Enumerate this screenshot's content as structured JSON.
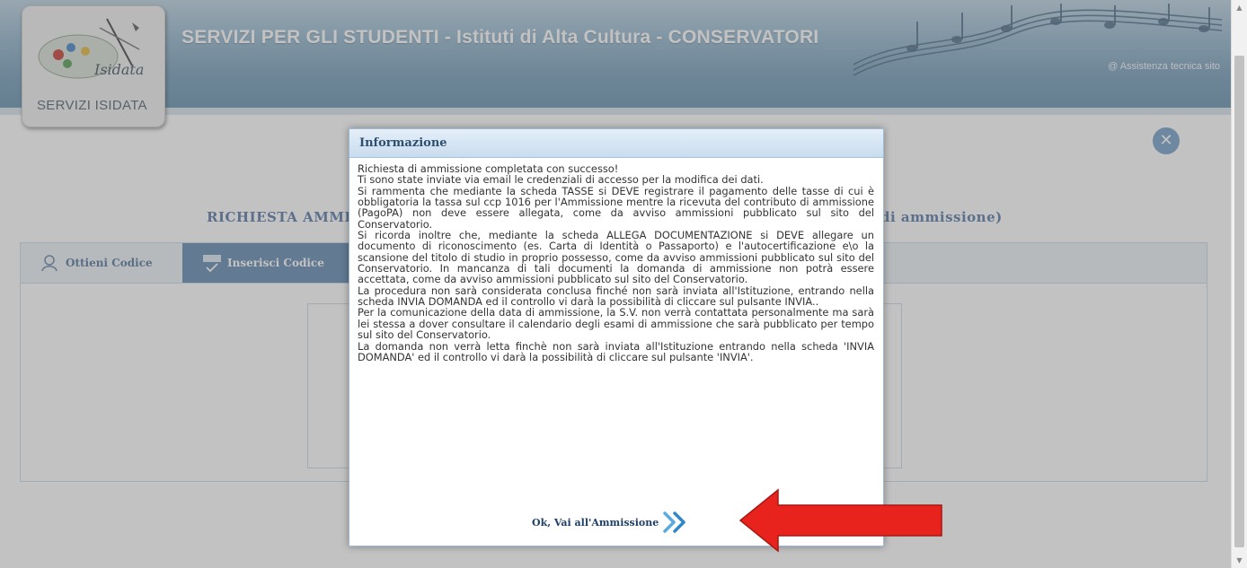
{
  "header": {
    "title": "SERVIZI PER GLI STUDENTI - Istituti di Alta Cultura - CONSERVATORI",
    "support_link": "@ Assistenza tecnica sito",
    "logo_label": "SERVIZI ISIDATA",
    "logo_brand": "Isidata"
  },
  "background": {
    "heading_left": "RICHIESTA AMMI",
    "heading_right": "di ammissione)",
    "tabs": [
      {
        "label": "Ottieni Codice"
      },
      {
        "label": "Inserisci Codice"
      }
    ]
  },
  "dialog": {
    "title": "Informazione",
    "paragraphs": [
      "Richiesta di ammissione completata con successo!",
      "Ti sono state inviate via email le credenziali di accesso per la modifica dei dati.",
      "Si rammenta che mediante la scheda TASSE si DEVE registrare il pagamento delle tasse di cui è obbligatoria la tassa sul ccp 1016 per l'Ammissione mentre la ricevuta del contributo di ammissione (PagoPA) non deve essere allegata, come da avviso ammissioni pubblicato sul sito del Conservatorio.",
      "Si ricorda inoltre che, mediante la scheda ALLEGA DOCUMENTAZIONE si DEVE allegare un documento di riconoscimento (es. Carta di Identità o Passaporto) e l'autocertificazione e\\o la scansione del titolo di studio in proprio possesso, come da avviso ammissioni pubblicato sul sito del Conservatorio. In mancanza di tali documenti la domanda di ammissione non potrà essere accettata, come da avviso ammissioni pubblicato sul sito del Conservatorio.",
      "La procedura non sarà considerata conclusa finché non sarà inviata all'Istituzione, entrando nella scheda INVIA DOMANDA ed il controllo vi darà la possibilità di cliccare sul pulsante INVIA..",
      "Per la comunicazione della data di ammissione, la S.V. non verrà contattata personalmente ma sarà lei stessa a dover consultare il calendario degli esami di ammissione che sarà pubblicato per tempo sul sito del Conservatorio.",
      "La domanda non verrà letta finchè non sarà inviata all'Istituzione entrando nella scheda 'INVIA DOMANDA' ed il controllo vi darà la possibilità di cliccare sul pulsante 'INVIA'."
    ],
    "ok_label": "Ok, Vai all'Ammissione"
  },
  "colors": {
    "header_blue": "#6e98b6",
    "dialog_title": "#2f4f6f",
    "annotation_arrow": "#e8231d"
  },
  "icons": [
    "close-icon",
    "chevron-double-right-icon",
    "user-icon",
    "code-icon",
    "music-notes-icon"
  ]
}
